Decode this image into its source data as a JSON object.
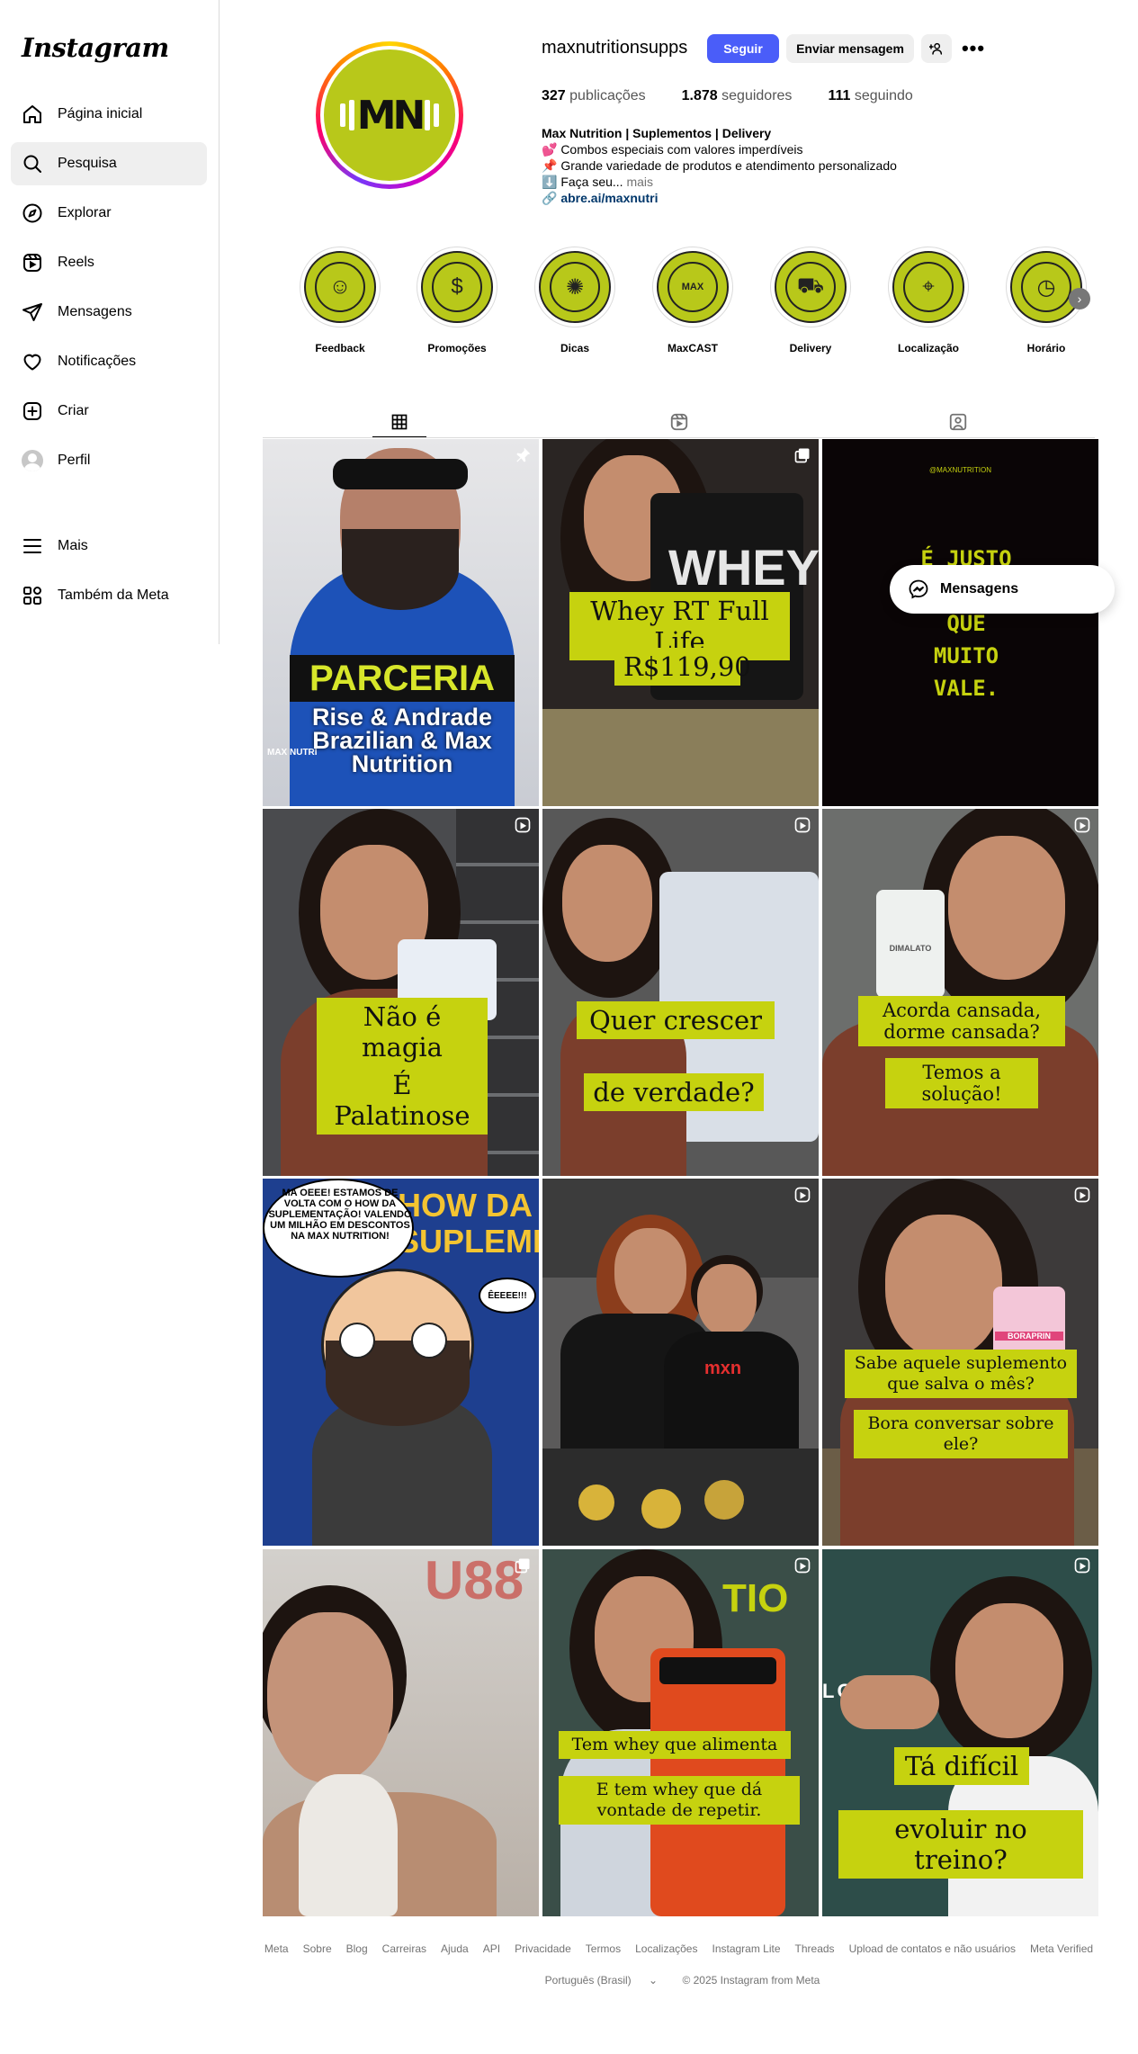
{
  "sidebar": {
    "logo": "Instagram",
    "items": [
      {
        "label": "Página inicial",
        "icon": "home-icon"
      },
      {
        "label": "Pesquisa",
        "icon": "search-icon",
        "active": true
      },
      {
        "label": "Explorar",
        "icon": "compass-icon"
      },
      {
        "label": "Reels",
        "icon": "reels-icon"
      },
      {
        "label": "Mensagens",
        "icon": "paper-plane-icon"
      },
      {
        "label": "Notificações",
        "icon": "heart-icon"
      },
      {
        "label": "Criar",
        "icon": "plus-square-icon"
      },
      {
        "label": "Perfil",
        "icon": "avatar-icon"
      },
      {
        "label": "Mais",
        "icon": "menu-icon"
      },
      {
        "label": "Também da Meta",
        "icon": "meta-apps-icon"
      }
    ]
  },
  "profile": {
    "username": "maxnutritionsupps",
    "follow_label": "Seguir",
    "message_label": "Enviar mensagem",
    "stats": {
      "posts_count": "327",
      "posts_label": "publicações",
      "followers_count": "1.878",
      "followers_label": "seguidores",
      "following_count": "111",
      "following_label": "seguindo"
    },
    "bio": {
      "name": "Max Nutrition | Suplementos | Delivery",
      "line1": "💕 Combos especiais com valores imperdíveis",
      "line2": "📌 Grande variedade de produtos e atendimento personalizado",
      "line3": "⬇️ Faça seu...",
      "more": "mais",
      "link": "abre.ai/maxnutri"
    }
  },
  "highlights": [
    {
      "label": "Feedback",
      "icon": "feedback-icon"
    },
    {
      "label": "Promoções",
      "icon": "coins-icon"
    },
    {
      "label": "Dicas",
      "icon": "lightbulb-icon"
    },
    {
      "label": "MaxCAST",
      "icon": "tv-icon"
    },
    {
      "label": "Delivery",
      "icon": "scooter-icon"
    },
    {
      "label": "Localização",
      "icon": "location-pin-icon"
    },
    {
      "label": "Horário",
      "icon": "clock-icon"
    }
  ],
  "posts": {
    "p1": {
      "title": "PARCERIA",
      "subtitle": "Rise & Andrade Brazilian & Max Nutrition",
      "shirt": "MAX NUTRI"
    },
    "p2": {
      "cap1": "Whey RT Full Life",
      "cap2": "R$119,90",
      "product": "WHEY"
    },
    "p3": {
      "handle": "@MAXNUTRITION",
      "text": "É JUSTO CUSTE O QUE MUITO VALE."
    },
    "p4": {
      "cap1": "Não é magia",
      "cap2": "É Palatinose"
    },
    "p5": {
      "cap1": "Quer crescer",
      "cap2": "de verdade?"
    },
    "p6": {
      "cap1": "Acorda cansada, dorme cansada?",
      "cap2": "Temos a solução!",
      "product": "DIMALATO"
    },
    "p7": {
      "bubble": "MA OEEE! ESTAMOS DE VOLTA COM O HOW DA SUPLEMENTAÇÃO! VALENDO UM MILHÃO EM DESCONTOS NA MAX NUTRITION!",
      "bubble2": "ÊEEEE!!!",
      "bg_text": "HOW DA SUPLEMENTAÇÃO"
    },
    "p8": {
      "shirt": "mxn"
    },
    "p9": {
      "cap1": "Sabe aquele suplemento que salva o mês?",
      "cap2": "Bora conversar sobre ele?",
      "product": "BORAPRIN"
    },
    "p10": {
      "sign": "U88"
    },
    "p11": {
      "cap1": "Tem whey que alimenta",
      "cap2": "E tem whey que dá vontade de repetir."
    },
    "p12": {
      "cap1": "Tá difícil",
      "cap2": "evoluir no treino?",
      "wall": "LOJA DE"
    }
  },
  "floating_messages": {
    "label": "Mensagens"
  },
  "footer": {
    "links": [
      "Meta",
      "Sobre",
      "Blog",
      "Carreiras",
      "Ajuda",
      "API",
      "Privacidade",
      "Termos",
      "Localizações",
      "Instagram Lite",
      "Threads",
      "Upload de contatos e não usuários",
      "Meta Verified"
    ],
    "language": "Português (Brasil)",
    "copyright": "© 2025 Instagram from Meta"
  },
  "colors": {
    "accent_blue": "#4a5df9",
    "brand_lime": "#c6d20f",
    "link_blue": "#00376b"
  }
}
